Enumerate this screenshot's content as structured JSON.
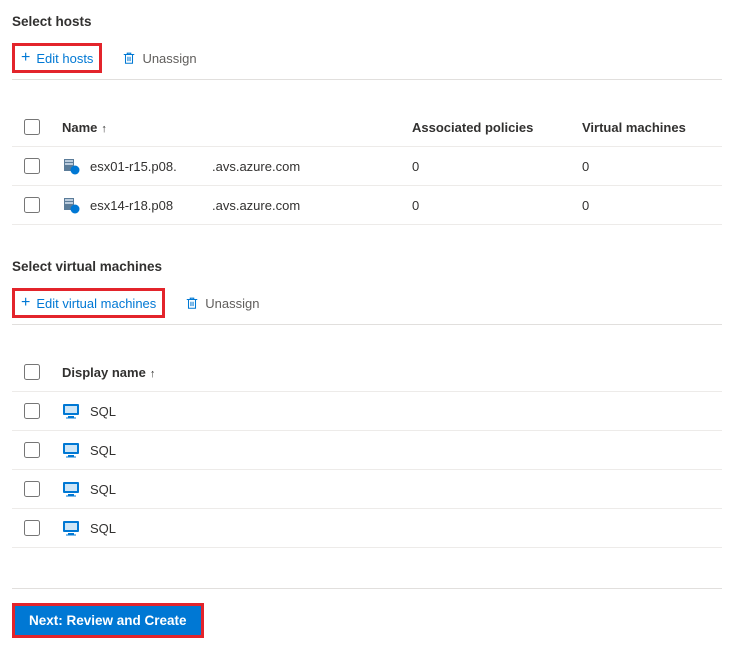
{
  "hosts": {
    "title": "Select hosts",
    "edit_label": "Edit hosts",
    "unassign_label": "Unassign",
    "columns": {
      "name": "Name",
      "policies": "Associated policies",
      "vms": "Virtual machines"
    },
    "rows": [
      {
        "name": "esx01-r15.p08.",
        "domain": ".avs.azure.com",
        "policies": "0",
        "vms": "0"
      },
      {
        "name": "esx14-r18.p08",
        "domain": ".avs.azure.com",
        "policies": "0",
        "vms": "0"
      }
    ]
  },
  "vms": {
    "title": "Select virtual machines",
    "edit_label": "Edit virtual machines",
    "unassign_label": "Unassign",
    "columns": {
      "display_name": "Display name"
    },
    "rows": [
      {
        "name": "SQL"
      },
      {
        "name": "SQL"
      },
      {
        "name": "SQL"
      },
      {
        "name": "SQL"
      }
    ]
  },
  "footer": {
    "next_label": "Next: Review and Create"
  }
}
